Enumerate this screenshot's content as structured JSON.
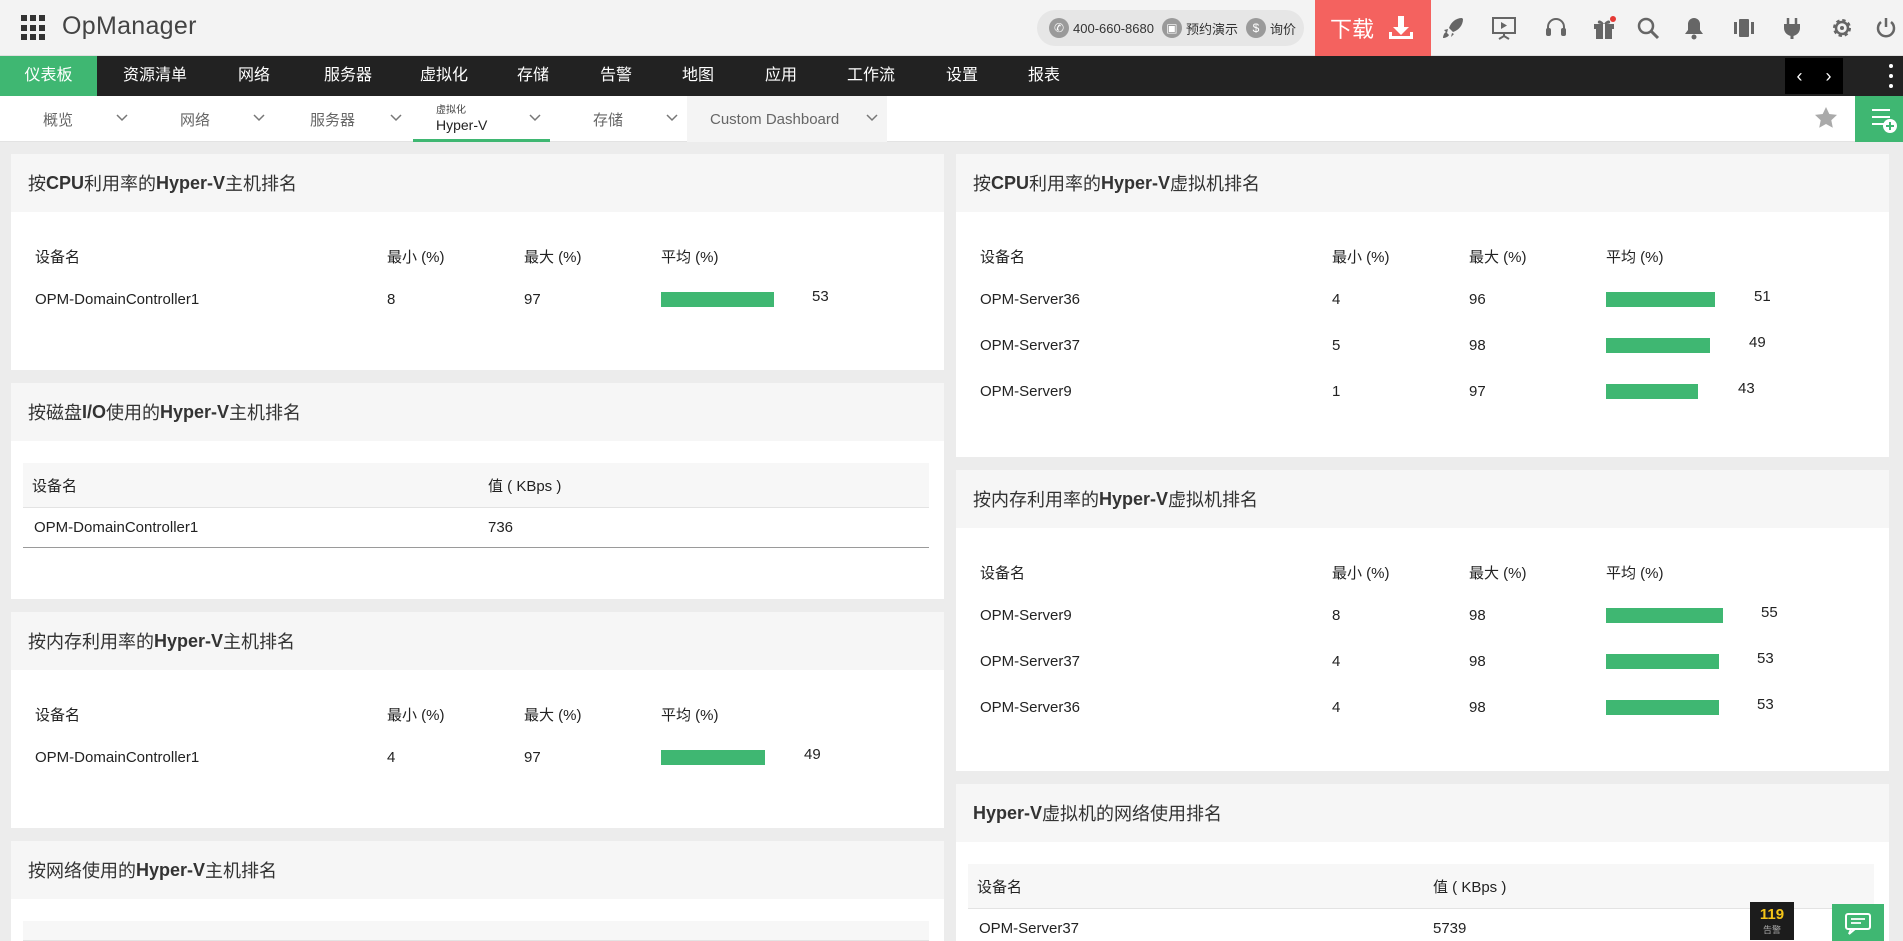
{
  "app": {
    "title": "OpManager",
    "phone": "400-660-8680",
    "demo_label": "预约演示",
    "quote_label": "询价",
    "download_label": "下载"
  },
  "main_nav": [
    {
      "label": "仪表板",
      "active": true
    },
    {
      "label": "资源清单"
    },
    {
      "label": "网络"
    },
    {
      "label": "服务器"
    },
    {
      "label": "虚拟化"
    },
    {
      "label": "存储"
    },
    {
      "label": "告警"
    },
    {
      "label": "地图"
    },
    {
      "label": "应用"
    },
    {
      "label": "工作流"
    },
    {
      "label": "设置"
    },
    {
      "label": "报表"
    }
  ],
  "sub_nav": [
    {
      "label": "概览"
    },
    {
      "label": "网络"
    },
    {
      "label": "服务器"
    },
    {
      "small": "虚拟化",
      "label": "Hyper-V",
      "active": true
    },
    {
      "label": "存储"
    },
    {
      "label": "Custom Dashboard"
    }
  ],
  "colors": {
    "accent": "#3fb772",
    "download": "#f4625f"
  },
  "panels": {
    "host_cpu": {
      "title_pre": "按",
      "title_bold": "CPU",
      "title_mid": "利用率的",
      "title_bold2": "Hyper-V",
      "title_post": "主机排名",
      "headers": [
        "设备名",
        "最小 (%)",
        "最大 (%)",
        "平均 (%)"
      ],
      "rows": [
        {
          "name": "OPM-DomainController1",
          "min": "8",
          "max": "97",
          "avg": "53",
          "avg_value": 53
        }
      ]
    },
    "host_disk": {
      "title_pre": "按磁盘",
      "title_bold": "I/O",
      "title_mid": "使用的",
      "title_bold2": "Hyper-V",
      "title_post": "主机排名",
      "headers": [
        "设备名",
        "值 ( KBps )"
      ],
      "rows": [
        {
          "name": "OPM-DomainController1",
          "value": "736"
        }
      ]
    },
    "host_mem": {
      "title_pre": "按内存利用率的",
      "title_bold": "Hyper-V",
      "title_post": "主机排名",
      "headers": [
        "设备名",
        "最小 (%)",
        "最大 (%)",
        "平均 (%)"
      ],
      "rows": [
        {
          "name": "OPM-DomainController1",
          "min": "4",
          "max": "97",
          "avg": "49",
          "avg_value": 49
        }
      ]
    },
    "host_net": {
      "title_pre": "按网络使用的",
      "title_bold": "Hyper-V",
      "title_post": "主机排名"
    },
    "vm_cpu": {
      "title_pre": "按",
      "title_bold": "CPU",
      "title_mid": "利用率的",
      "title_bold2": "Hyper-V",
      "title_post": "虚拟机排名",
      "headers": [
        "设备名",
        "最小 (%)",
        "最大 (%)",
        "平均 (%)"
      ],
      "rows": [
        {
          "name": "OPM-Server36",
          "min": "4",
          "max": "96",
          "avg": "51",
          "avg_value": 51
        },
        {
          "name": "OPM-Server37",
          "min": "5",
          "max": "98",
          "avg": "49",
          "avg_value": 49
        },
        {
          "name": "OPM-Server9",
          "min": "1",
          "max": "97",
          "avg": "43",
          "avg_value": 43
        }
      ]
    },
    "vm_mem": {
      "title_pre": "按内存利用率的",
      "title_bold": "Hyper-V",
      "title_post": "虚拟机排名",
      "headers": [
        "设备名",
        "最小 (%)",
        "最大 (%)",
        "平均 (%)"
      ],
      "rows": [
        {
          "name": "OPM-Server9",
          "min": "8",
          "max": "98",
          "avg": "55",
          "avg_value": 55
        },
        {
          "name": "OPM-Server37",
          "min": "4",
          "max": "98",
          "avg": "53",
          "avg_value": 53
        },
        {
          "name": "OPM-Server36",
          "min": "4",
          "max": "98",
          "avg": "53",
          "avg_value": 53
        }
      ]
    },
    "vm_net": {
      "title_bold": "Hyper-V",
      "title_post": "虚拟机的网络使用排名",
      "headers": [
        "设备名",
        "值 ( KBps )"
      ],
      "rows": [
        {
          "name": "OPM-Server37",
          "value": "5739"
        }
      ]
    }
  },
  "alarm_badge": {
    "count": "119",
    "label": "告警"
  }
}
